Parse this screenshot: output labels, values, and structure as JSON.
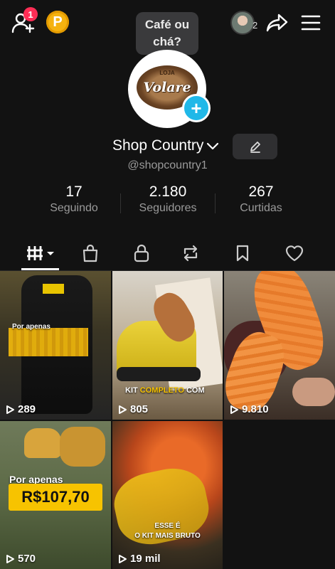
{
  "topbar": {
    "add_friends_badge": "1",
    "coin_label": "P",
    "tooltip": "Café ou\nchá?",
    "avatar_count": "2"
  },
  "profile": {
    "logo_top_text": "LOJA",
    "logo_text": "Volare",
    "name": "Shop Country",
    "handle": "@shopcountry1",
    "stats": [
      {
        "value": "17",
        "label": "Seguindo"
      },
      {
        "value": "2.180",
        "label": "Seguidores"
      },
      {
        "value": "267",
        "label": "Curtidas"
      }
    ]
  },
  "tabs": [
    "videos-grid",
    "shop-bag",
    "private-lock",
    "reposts",
    "bookmarks",
    "likes"
  ],
  "videos": [
    {
      "views": "289",
      "caption": "Por apenas"
    },
    {
      "views": "805",
      "caption_a": "KIT ",
      "caption_b": "COMPLETO",
      "caption_c": " COM"
    },
    {
      "views": "9.810"
    },
    {
      "views": "570",
      "caption": "Por apenas",
      "price": "R$107,70"
    },
    {
      "views": "19 mil",
      "caption_1": "ESSE É",
      "caption_2": "O KIT MAIS BRUTO"
    }
  ],
  "colors": {
    "background": "#121212",
    "accent_blue": "#20b8e8",
    "badge_red": "#ff2d55",
    "coin_gold": "#f5b20f",
    "price_yellow": "#f7c300"
  }
}
